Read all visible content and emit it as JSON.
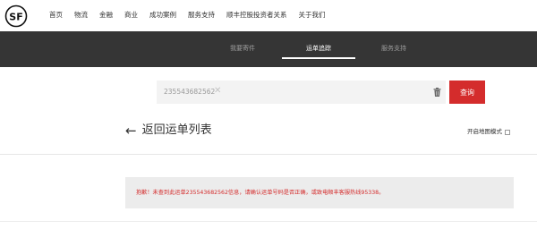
{
  "brand": {
    "logo_text": "SF"
  },
  "topnav": {
    "items": [
      "首页",
      "物流",
      "金融",
      "商业",
      "成功案例",
      "服务支持",
      "顺丰控股投资者关系",
      "关于我们"
    ]
  },
  "subnav": {
    "tabs": [
      {
        "label": "我要寄件",
        "active": false
      },
      {
        "label": "运单追踪",
        "active": true
      },
      {
        "label": "服务支持",
        "active": false
      }
    ]
  },
  "search": {
    "value": "235543682562",
    "button_label": "查询"
  },
  "page": {
    "back_label": "返回运单列表",
    "map_mode_label": "开启地图模式",
    "map_mode_checked": false
  },
  "alert": {
    "message": "抱歉！未查到此运单235543682562信息，请确认运单号码是否正确，或致电顺丰客服热线95338。"
  },
  "colors": {
    "accent": "#d42c2c",
    "subnav_bg": "#353535",
    "alert_bg": "#ececec"
  }
}
